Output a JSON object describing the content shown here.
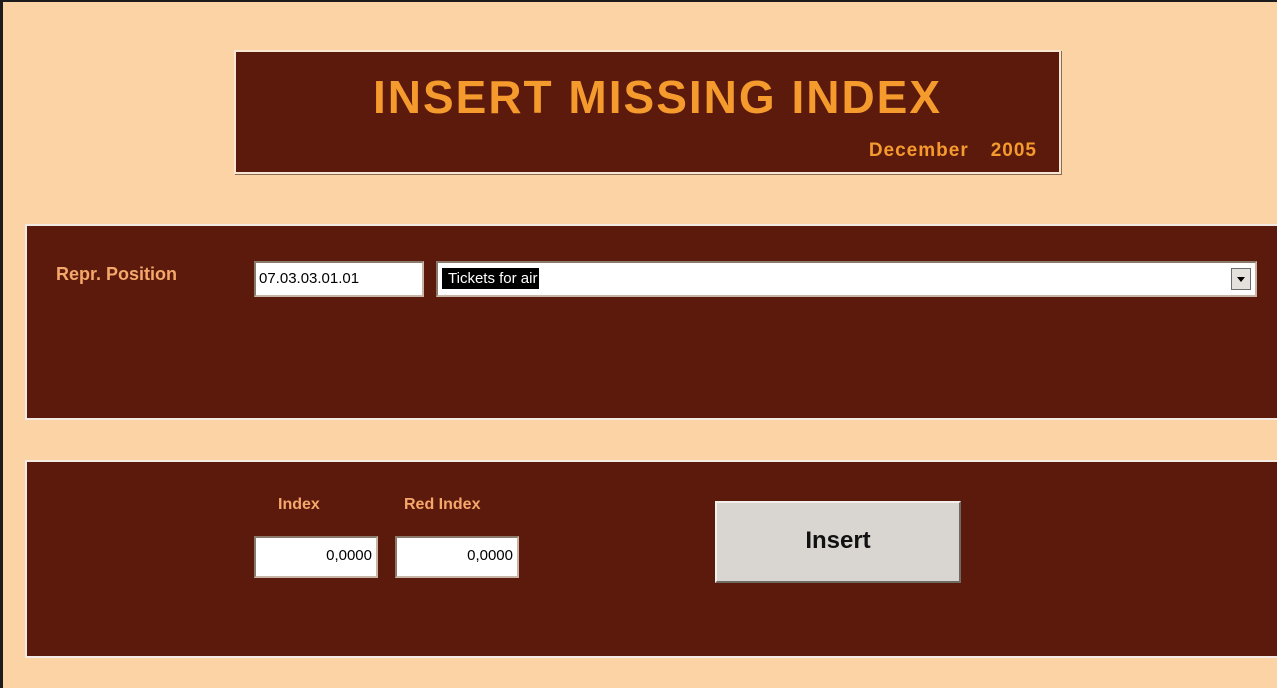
{
  "header": {
    "title": "INSERT MISSING INDEX",
    "month": "December",
    "year": "2005"
  },
  "position_panel": {
    "label": "Repr. Position",
    "position_value": "07.03.03.01.01",
    "combo_value": "Tickets for air"
  },
  "index_panel": {
    "index_label": "Index",
    "red_index_label": "Red Index",
    "index_value": "0,0000",
    "red_index_value": "0,0000",
    "insert_label": "Insert"
  },
  "colors": {
    "background": "#fbd3a5",
    "panel": "#5c1a0d",
    "title_text": "#f59a2c",
    "label_text": "#f5a86a"
  }
}
